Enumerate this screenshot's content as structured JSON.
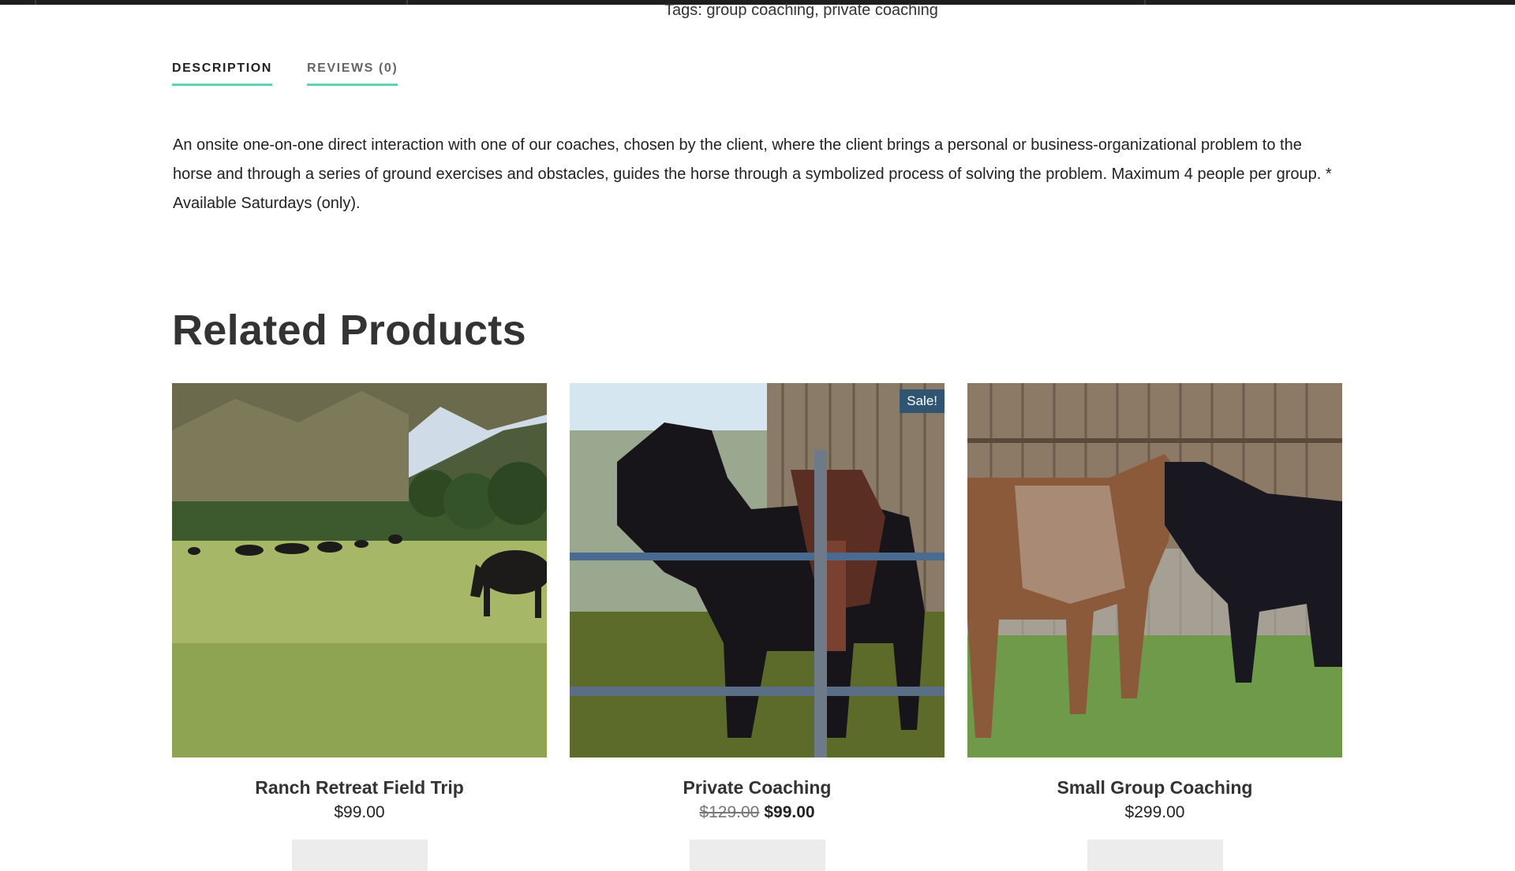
{
  "tags_line": "Tags: group coaching, private coaching",
  "tabs": [
    {
      "label": "DESCRIPTION",
      "active": true
    },
    {
      "label": "REVIEWS (0)",
      "active": false
    }
  ],
  "description": "An onsite one-on-one direct interaction with one of our coaches, chosen by the client, where the client brings a personal or business-organizational problem to the horse and through a series of ground exercises and obstacles, guides the horse through a symbolized process of solving the problem. Maximum 4 people per group. * Available Saturdays (only).",
  "related": {
    "title": "Related Products",
    "products": [
      {
        "name": "Ranch Retreat Field Trip",
        "price": "$99.00",
        "old_price": "",
        "sale_badge": ""
      },
      {
        "name": "Private Coaching",
        "price": "$99.00",
        "old_price": "$129.00",
        "sale_badge": "Sale!"
      },
      {
        "name": "Small Group Coaching",
        "price": "$299.00",
        "old_price": "",
        "sale_badge": ""
      }
    ]
  },
  "colors": {
    "tab_underline": "#5fd3b6",
    "sale_badge_bg": "#2f5572",
    "top_bar": "#1e1e1e"
  }
}
